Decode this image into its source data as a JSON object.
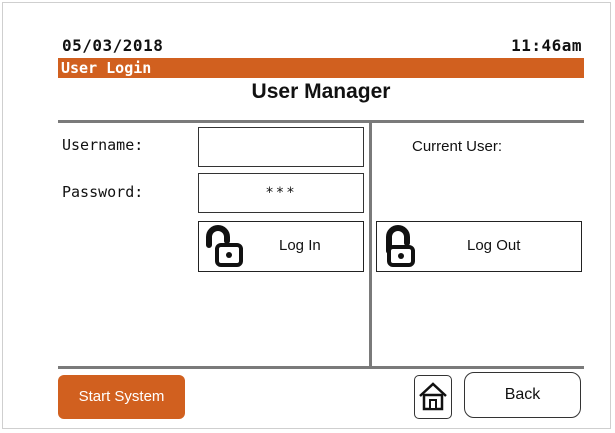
{
  "header": {
    "date": "05/03/2018",
    "time": "11:46am"
  },
  "status_bar": {
    "label": "User Login"
  },
  "page": {
    "title": "User Manager"
  },
  "form": {
    "username_label": "Username:",
    "username_value": "",
    "password_label": "Password:",
    "password_value": "***"
  },
  "current_user": {
    "label": "Current User:"
  },
  "buttons": {
    "login_label": "Log In",
    "logout_label": "Log Out",
    "start_label": "Start System",
    "back_label": "Back"
  },
  "icons": {
    "login": "lock-icon",
    "logout": "lock-icon",
    "home": "home-icon"
  },
  "colors": {
    "accent": "#d1601f",
    "divider": "#7a7a7a"
  }
}
